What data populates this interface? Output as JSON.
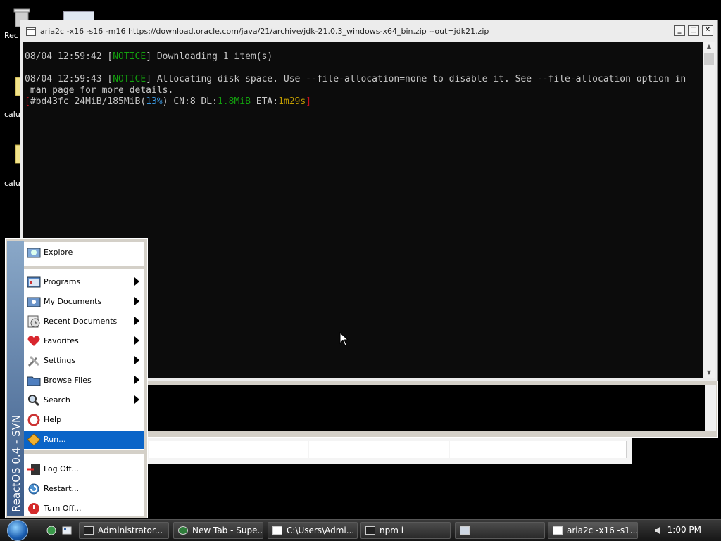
{
  "desktop": {
    "icons": [
      {
        "label": "Rec",
        "icon": "recycle-bin-icon"
      },
      {
        "label": "calul",
        "icon": "folder-icon"
      },
      {
        "label": "calul",
        "icon": "folder-icon"
      }
    ]
  },
  "console": {
    "title": "aria2c  -x16 -s16 -m16 https://download.oracle.com/java/21/archive/jdk-21.0.3_windows-x64_bin.zip --out=jdk21.zip",
    "lines": {
      "l1_time": "08/04 12:59:42 ",
      "l1_tag": "NOTICE",
      "l1_msg": " Downloading 1 item(s)",
      "l2_time": "08/04 12:59:43 ",
      "l2_tag": "NOTICE",
      "l2_msg": " Allocating disk space. Use --file-allocation=none to disable it. See --file-allocation option in",
      "l3": " man page for more details.",
      "p_gid": "#bd43fc 24MiB/185MiB",
      "p_pct": "13%",
      "p_cn": " CN:8 DL:",
      "p_dl": "1.8MiB",
      "p_eta_label": " ETA:",
      "p_eta": "1m29s"
    },
    "controls": {
      "minimize": "_",
      "maximize": "□",
      "close": "✕"
    }
  },
  "start_menu": {
    "brand": "ReactOS  0.4 - SVN",
    "items": [
      {
        "label": "Explore",
        "icon": "explore-icon"
      },
      {
        "label": "Programs",
        "icon": "programs-icon"
      },
      {
        "label": "My Documents",
        "icon": "my-documents-icon"
      },
      {
        "label": "Recent Documents",
        "icon": "recent-documents-icon"
      },
      {
        "label": "Favorites",
        "icon": "favorites-icon"
      },
      {
        "label": "Settings",
        "icon": "settings-icon"
      },
      {
        "label": "Browse Files",
        "icon": "browse-files-icon"
      },
      {
        "label": "Search",
        "icon": "search-icon"
      },
      {
        "label": "Help",
        "icon": "help-icon"
      },
      {
        "label": "Run...",
        "icon": "run-icon"
      },
      {
        "label": "Log Off...",
        "icon": "log-off-icon"
      },
      {
        "label": "Restart...",
        "icon": "restart-icon"
      },
      {
        "label": "Turn Off...",
        "icon": "turn-off-icon"
      }
    ]
  },
  "taskbar": {
    "tasks": [
      {
        "label": "Administrator..."
      },
      {
        "label": "New Tab - Supe..."
      },
      {
        "label": "C:\\Users\\Admi..."
      },
      {
        "label": "npm i"
      },
      {
        "label": ""
      },
      {
        "label": "aria2c  -x16 -s1..."
      }
    ],
    "clock": "1:00 PM"
  },
  "colors": {
    "selection": "#0a64c8",
    "notice": "#13a10e",
    "percent": "#3a96dd",
    "eta": "#c19c00"
  }
}
